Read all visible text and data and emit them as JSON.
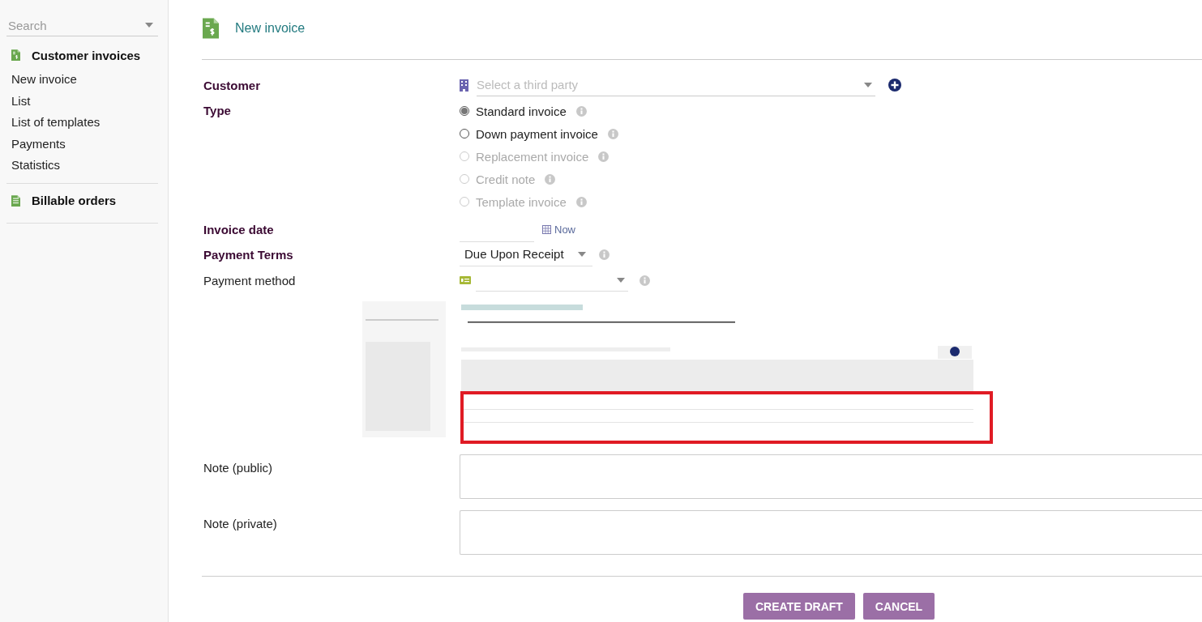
{
  "sidebar": {
    "search": {
      "placeholder": "Search"
    },
    "sections": [
      {
        "title": "Customer invoices",
        "items": [
          "New invoice",
          "List",
          "List of templates",
          "Payments",
          "Statistics"
        ]
      },
      {
        "title": "Billable orders"
      }
    ]
  },
  "page": {
    "title": "New invoice"
  },
  "form": {
    "customer": {
      "label": "Customer",
      "required": true,
      "placeholder": "Select a third party"
    },
    "type": {
      "label": "Type",
      "required": true,
      "options": [
        {
          "label": "Standard invoice",
          "selected": true,
          "disabled": false
        },
        {
          "label": "Down payment invoice",
          "selected": false,
          "disabled": false
        },
        {
          "label": "Replacement invoice",
          "selected": false,
          "disabled": true
        },
        {
          "label": "Credit note",
          "selected": false,
          "disabled": true
        },
        {
          "label": "Template invoice",
          "selected": false,
          "disabled": true
        }
      ]
    },
    "invoice_date": {
      "label": "Invoice date",
      "required": true,
      "link": "Now"
    },
    "payment_terms": {
      "label": "Payment Terms",
      "required": true,
      "value": "Due Upon Receipt"
    },
    "payment_method": {
      "label": "Payment method",
      "required": false
    },
    "notes": [
      {
        "label": "Note (public)",
        "required": false
      },
      {
        "label": "Note (private)",
        "required": false
      }
    ],
    "buttons": [
      {
        "label": "CREATE DRAFT"
      },
      {
        "label": "CANCEL"
      }
    ]
  }
}
